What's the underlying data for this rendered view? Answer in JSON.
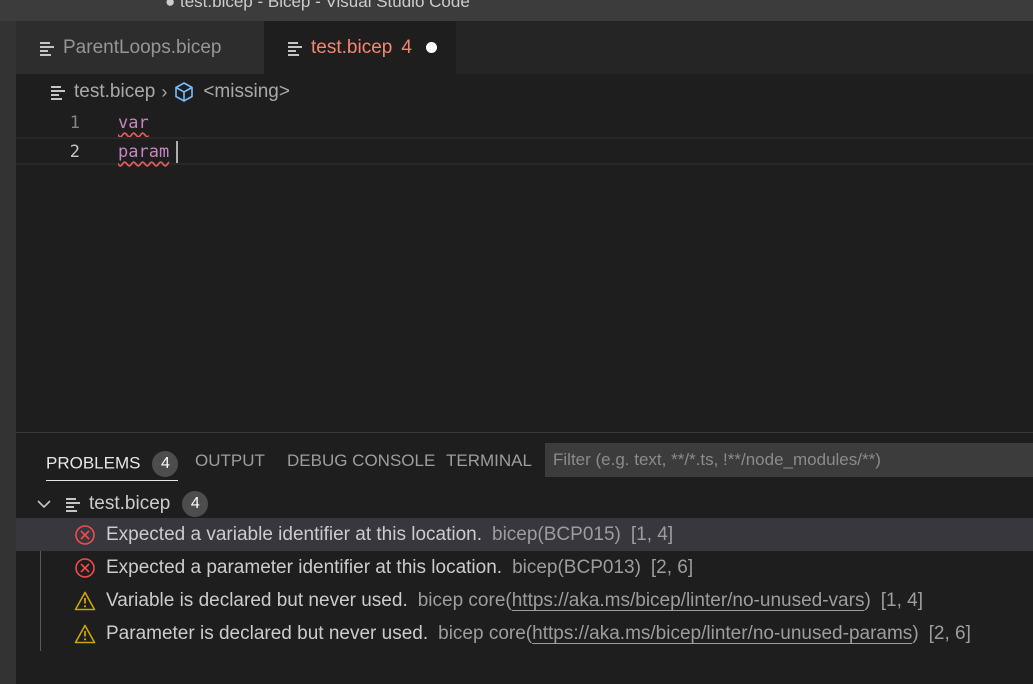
{
  "window": {
    "title": "● test.bicep - Bicep - Visual Studio Code"
  },
  "tabs": [
    {
      "label": "ParentLoops.bicep",
      "active": false
    },
    {
      "label": "test.bicep",
      "count": "4",
      "active": true,
      "dirty": true
    }
  ],
  "breadcrumb": {
    "file": "test.bicep",
    "symbol": "<missing>"
  },
  "editor": {
    "lines": [
      {
        "number": "1",
        "code": "var"
      },
      {
        "number": "2",
        "code": "param"
      }
    ]
  },
  "panel": {
    "tabs": [
      {
        "label": "PROBLEMS",
        "badge": "4"
      },
      {
        "label": "OUTPUT"
      },
      {
        "label": "DEBUG CONSOLE"
      },
      {
        "label": "TERMINAL"
      }
    ],
    "filter_placeholder": "Filter (e.g. text, **/*.ts, !**/node_modules/**)",
    "tree": {
      "file": "test.bicep",
      "count": "4"
    },
    "problems": [
      {
        "severity": "error",
        "message": "Expected a variable identifier at this location.",
        "source": "bicep(BCP015)",
        "position": "[1, 4]"
      },
      {
        "severity": "error",
        "message": "Expected a parameter identifier at this location.",
        "source": "bicep(BCP013)",
        "position": "[2, 6]"
      },
      {
        "severity": "warning",
        "message": "Variable is declared but never used.",
        "source_prefix": "bicep core(",
        "link": "https://aka.ms/bicep/linter/no-unused-vars",
        "source_suffix": ")",
        "position": "[1, 4]"
      },
      {
        "severity": "warning",
        "message": "Parameter is declared but never used.",
        "source_prefix": "bicep core(",
        "link": "https://aka.ms/bicep/linter/no-unused-params",
        "source_suffix": ")",
        "position": "[2, 6]"
      }
    ]
  },
  "colors": {
    "error": "#f14c4c",
    "warning": "#cca700",
    "active_tab_text": "#f48771",
    "keyword": "#c586c0"
  }
}
